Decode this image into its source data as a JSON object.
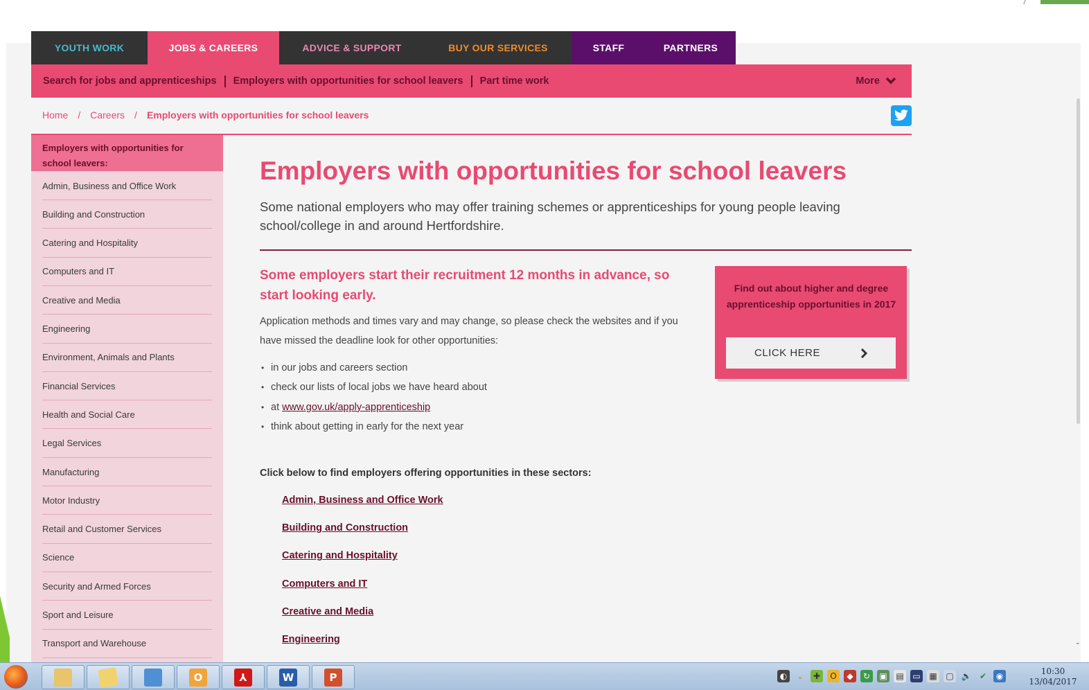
{
  "top_nav": [
    {
      "label": "YOUTH WORK",
      "bg": "#333333",
      "fg": "#4bb8c9",
      "width": 168
    },
    {
      "label": "JOBS & CAREERS",
      "bg": "#e84a72",
      "fg": "#ffffff",
      "width": 190
    },
    {
      "label": "ADVICE & SUPPORT",
      "bg": "#333333",
      "fg": "#e889b0",
      "width": 210
    },
    {
      "label": "BUY OUR SERVICES",
      "bg": "#333333",
      "fg": "#f08c2a",
      "width": 212
    },
    {
      "label": "STAFF",
      "bg": "#5b0f6a",
      "fg": "#ffffff",
      "width": 107
    },
    {
      "label": "PARTNERS",
      "bg": "#5b0f6a",
      "fg": "#ffffff",
      "width": 130
    }
  ],
  "sub_nav": {
    "links": [
      "Search for jobs and apprenticeships",
      "Employers with opportunities for school leavers",
      "Part time work"
    ],
    "more": "More"
  },
  "breadcrumb": {
    "home": "Home",
    "sep": "/",
    "careers": "Careers",
    "current": "Employers with opportunities for school leavers"
  },
  "sidebar": {
    "header": "Employers with opportunities for school leavers:",
    "items": [
      "Admin, Business and Office Work",
      "Building and Construction",
      "Catering and Hospitality",
      "Computers and IT",
      "Creative and Media",
      "Engineering",
      "Environment, Animals and Plants",
      "Financial Services",
      "Health and Social Care",
      "Legal Services",
      "Manufacturing",
      "Motor Industry",
      "Retail and Customer Services",
      "Science",
      "Security and Armed Forces",
      "Sport and Leisure",
      "Transport and Warehouse"
    ]
  },
  "main": {
    "title": "Employers with opportunities for school leavers",
    "intro": "Some national employers who may offer training schemes or apprenticeships for young people leaving school/college in and around Hertfordshire.",
    "warning": "Some employers start their recruitment 12 months in advance, so start looking early.",
    "paragraph": "Application methods and times vary and may change, so please check the websites and if you have missed the deadline look for other opportunities:",
    "bullets": {
      "b1": "in our jobs and careers section",
      "b2": "check our lists of local jobs we have heard about",
      "b3_prefix": "at ",
      "b3_link": "www.gov.uk/apply-apprenticeship",
      "b4": "think about getting in early for the next year"
    },
    "sectors_intro": "Click below to find employers offering opportunities in these sectors:",
    "sector_links": [
      "Admin, Business and Office Work",
      "Building and Construction",
      "Catering and Hospitality",
      "Computers and IT",
      "Creative and Media",
      "Engineering"
    ]
  },
  "promo": {
    "text": "Find out about higher and degree apprenticeship opportunities in 2017",
    "button": "CLICK HERE"
  },
  "taskbar": {
    "apps": [
      "firefox",
      "file-explorer",
      "folder",
      "lync",
      "outlook",
      "acrobat",
      "word",
      "powerpoint"
    ],
    "word_letter": "W",
    "outlook_letter": "O",
    "powerpoint_letter": "P",
    "time": "10:30",
    "date": "13/04/2017"
  },
  "colors": {
    "brand_pink": "#e84a72",
    "dark_maroon": "#6a0f2a",
    "sidebar_bg": "#f1d4dc",
    "twitter_blue": "#1da1f2"
  }
}
